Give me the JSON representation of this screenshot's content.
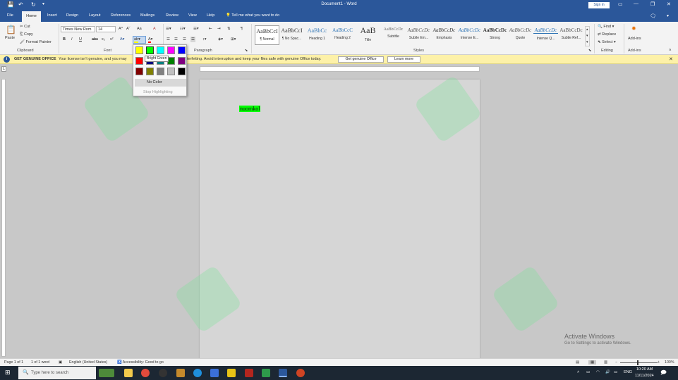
{
  "titlebar": {
    "title": "Document1 - Word",
    "sign_in": "Sign in",
    "qa_save": "💾",
    "qa_undo": "↶",
    "qa_redo": "↻",
    "qa_more": "▾"
  },
  "tabs": [
    {
      "label": "File"
    },
    {
      "label": "Home"
    },
    {
      "label": "Insert"
    },
    {
      "label": "Design"
    },
    {
      "label": "Layout"
    },
    {
      "label": "References"
    },
    {
      "label": "Mailings"
    },
    {
      "label": "Review"
    },
    {
      "label": "View"
    },
    {
      "label": "Help"
    }
  ],
  "tell_me": "Tell me what you want to do",
  "clipboard": {
    "paste": "Paste",
    "cut": "Cut",
    "copy": "Copy",
    "format_painter": "Format Painter",
    "label": "Clipboard"
  },
  "font": {
    "name": "Times New Rom",
    "size": "14",
    "label": "Font",
    "bold": "B",
    "italic": "I",
    "underline": "U",
    "strike": "abc",
    "sub": "x₂",
    "sup": "x²",
    "grow": "A^",
    "shrink": "Aˇ",
    "case": "Aa",
    "clear": "A"
  },
  "paragraph": {
    "label": "Paragraph",
    "mark": "¶"
  },
  "styles": {
    "label": "Styles",
    "items": [
      {
        "sample": "AaBbCcI",
        "name": "¶ Normal"
      },
      {
        "sample": "AaBbCcI",
        "name": "¶ No Spac..."
      },
      {
        "sample": "AaBbCc",
        "name": "Heading 1"
      },
      {
        "sample": "AaBbCcC",
        "name": "Heading 2"
      },
      {
        "sample": "AaB",
        "name": "Title"
      },
      {
        "sample": "AaBbCcDc",
        "name": "Subtitle"
      },
      {
        "sample": "AaBbCcDc",
        "name": "Subtle Em..."
      },
      {
        "sample": "AaBbCcDc",
        "name": "Emphasis"
      },
      {
        "sample": "AaBbCcDc",
        "name": "Intense E..."
      },
      {
        "sample": "AaBbCcDc",
        "name": "Strong"
      },
      {
        "sample": "AaBbCcDc",
        "name": "Quote"
      },
      {
        "sample": "AaBbCcDc",
        "name": "Intense Q..."
      },
      {
        "sample": "AaBbCcDc",
        "name": "Subtle Ref..."
      }
    ]
  },
  "editing": {
    "find": "Find",
    "replace": "Replace",
    "select": "Select",
    "label": "Editing"
  },
  "addins": {
    "name": "Add-ins",
    "label": "Add-ins"
  },
  "infobar": {
    "title": "GET GENUINE OFFICE",
    "message": "Your license isn't genuine, and you may",
    "message2": "terfeiting. Avoid interruption and keep your files safe with genuine Office today.",
    "btn_genuine": "Get genuine Office",
    "btn_learn": "Learn more"
  },
  "highlight_menu": {
    "tooltip": "Bright Green",
    "no_color": "No Color",
    "stop": "Stop Highlighting",
    "colors": [
      "#ffff00",
      "#00ff00",
      "#00ffff",
      "#ff00ff",
      "#0000ff",
      "#ff0000",
      "#000080",
      "#008080",
      "#008000",
      "#800080",
      "#800000",
      "#808000",
      "#808080",
      "#c0c0c0",
      "#000000"
    ]
  },
  "document": {
    "text": "nuomkol"
  },
  "status": {
    "page": "Page 1 of 1",
    "words": "1 of 1 word",
    "language": "English (United States)",
    "accessibility": "Accessibility: Good to go",
    "zoom": "100%"
  },
  "activate": {
    "title": "Activate Windows",
    "subtitle": "Go to Settings to activate Windows."
  },
  "taskbar": {
    "search": "Type here to search",
    "lang": "ENG",
    "time": "10:20 AM",
    "date": "11/11/2024"
  }
}
